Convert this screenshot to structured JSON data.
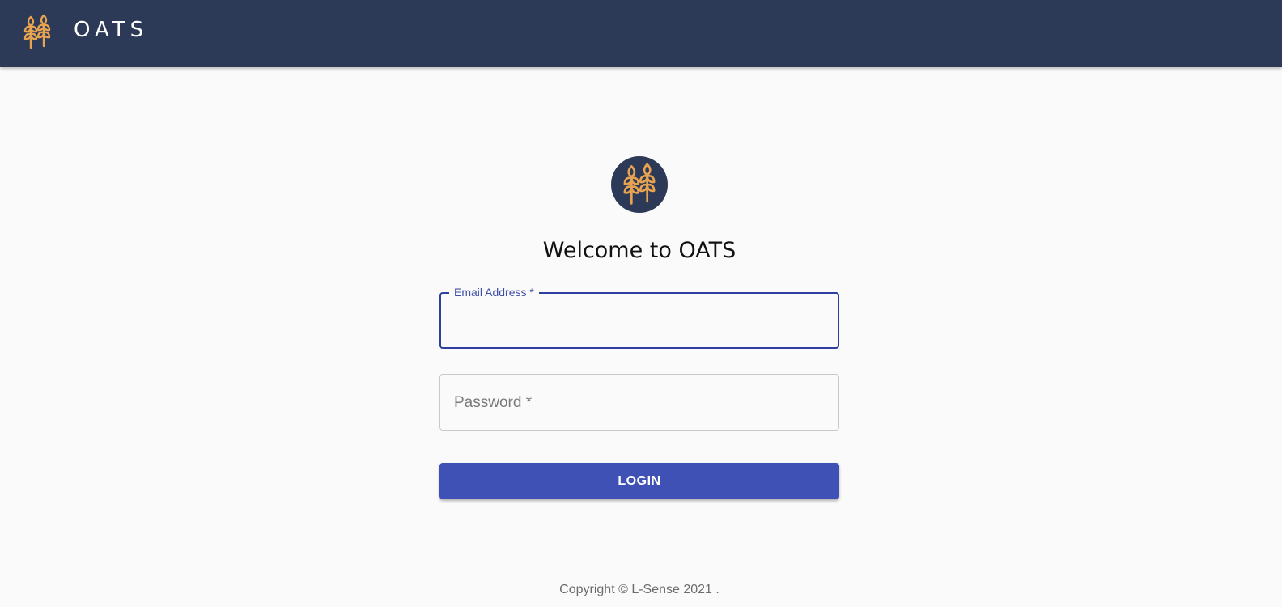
{
  "header": {
    "title": "OATS",
    "logo_icon": "wheat-icon",
    "background_color": "#2d3a57",
    "logo_color": "#e7a34f"
  },
  "login": {
    "avatar_icon": "wheat-icon",
    "welcome_title": "Welcome to OATS",
    "email_label": "Email Address *",
    "email_value": "",
    "password_label": "Password *",
    "button_label": "LOGIN",
    "accent_color": "#3f51b5"
  },
  "footer": {
    "copyright": "Copyright © L-Sense 2021 ."
  }
}
